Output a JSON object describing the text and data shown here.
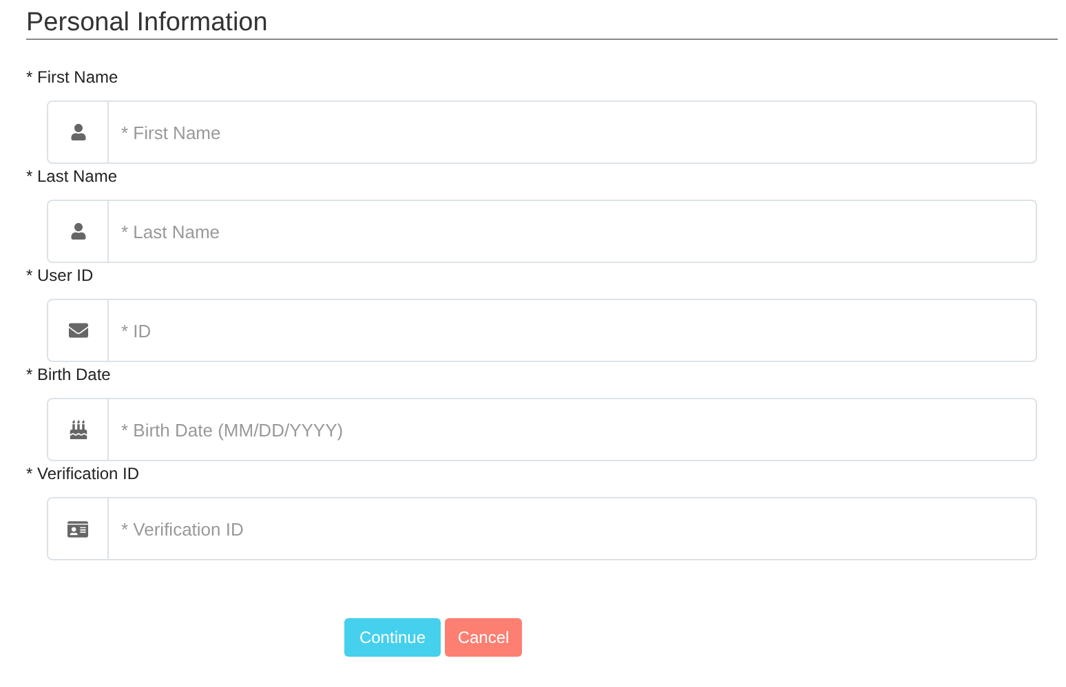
{
  "section": {
    "title": "Personal Information"
  },
  "fields": [
    {
      "label": "* First Name",
      "placeholder": "* First Name",
      "kind": "person"
    },
    {
      "label": "* Last Name",
      "placeholder": "* Last Name",
      "kind": "person"
    },
    {
      "label": "* User ID",
      "placeholder": "* ID",
      "kind": "mail"
    },
    {
      "label": "* Birth Date",
      "placeholder": "* Birth Date (MM/DD/YYYY)",
      "kind": "cake"
    },
    {
      "label": "* Verification ID",
      "placeholder": "* Verification ID",
      "kind": "card"
    }
  ],
  "buttons": [
    {
      "label": "Continue",
      "kind": "primary"
    },
    {
      "label": "Cancel",
      "kind": "danger"
    }
  ]
}
